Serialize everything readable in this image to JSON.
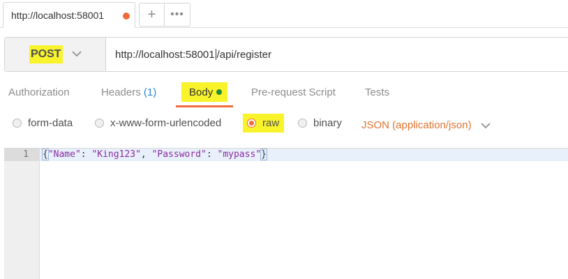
{
  "tabs": {
    "active_tab_title": "http://localhost:58001",
    "unsaved_dot_color": "#f26b3a",
    "new_tab_label": "+",
    "more_label": "•••"
  },
  "request": {
    "method": "POST",
    "url_before_caret": "http://localhost:58001",
    "url_after_caret": "/api/register"
  },
  "subtabs": {
    "authorization": "Authorization",
    "headers": "Headers",
    "headers_count": "(1)",
    "body": "Body",
    "prerequest": "Pre-request Script",
    "tests": "Tests"
  },
  "body_types": {
    "form_data": "form-data",
    "urlencoded": "x-www-form-urlencoded",
    "raw": "raw",
    "binary": "binary",
    "selected": "raw",
    "content_type": "JSON (application/json)"
  },
  "editor": {
    "line_number": "1",
    "tokens": {
      "open": "{",
      "k1": "\"Name\"",
      "c1": ": ",
      "v1": "\"King123\"",
      "s1": ", ",
      "k2": "\"Password\"",
      "c2": ": ",
      "v2": "\"mypass\"",
      "close": "}"
    }
  },
  "colors": {
    "accent": "#f26b3a",
    "highlight": "#f8f32b",
    "body_indicator": "#1e8c3a",
    "headers_count": "#2a8bd8"
  }
}
